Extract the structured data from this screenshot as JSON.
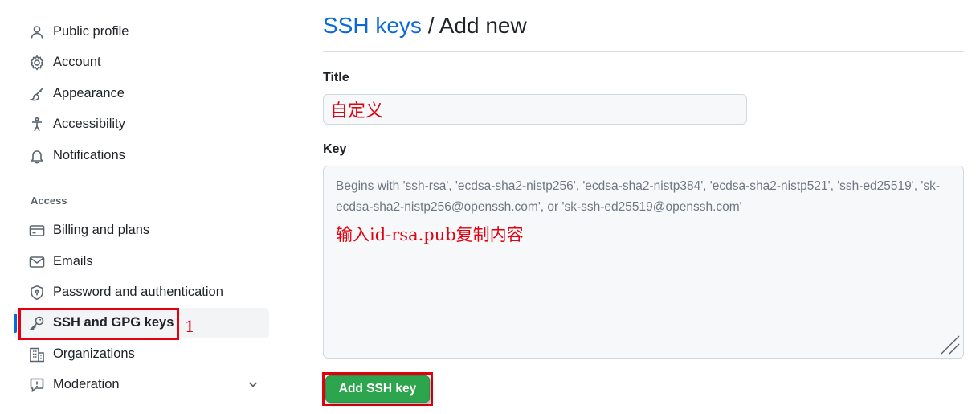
{
  "sidebar": {
    "items": [
      {
        "label": "Public profile",
        "icon": "person-icon"
      },
      {
        "label": "Account",
        "icon": "gear-icon"
      },
      {
        "label": "Appearance",
        "icon": "paintbrush-icon"
      },
      {
        "label": "Accessibility",
        "icon": "accessibility-icon"
      },
      {
        "label": "Notifications",
        "icon": "bell-icon"
      }
    ],
    "access_heading": "Access",
    "access_items": [
      {
        "label": "Billing and plans",
        "icon": "credit-card-icon"
      },
      {
        "label": "Emails",
        "icon": "mail-icon"
      },
      {
        "label": "Password and authentication",
        "icon": "shield-lock-icon"
      },
      {
        "label": "SSH and GPG keys",
        "icon": "key-icon",
        "active": true
      },
      {
        "label": "Organizations",
        "icon": "organization-icon"
      },
      {
        "label": "Moderation",
        "icon": "report-icon",
        "expandable": true
      }
    ]
  },
  "annotations": {
    "sidebar_step": "1",
    "title_example": "自定义",
    "key_instruction": "输入id-rsa.pub复制内容"
  },
  "main": {
    "breadcrumb_link": "SSH keys",
    "breadcrumb_separator": "/",
    "page_title": "Add new",
    "title_label": "Title",
    "key_label": "Key",
    "key_placeholder": "Begins with 'ssh-rsa', 'ecdsa-sha2-nistp256', 'ecdsa-sha2-nistp384', 'ecdsa-sha2-nistp521', 'ssh-ed25519', 'sk-ecdsa-sha2-nistp256@openssh.com', or 'sk-ssh-ed25519@openssh.com'",
    "submit_label": "Add SSH key"
  },
  "colors": {
    "link_blue": "#0969da",
    "active_indicator": "#0969da",
    "primary_button": "#2da44e",
    "annotation_red": "#e3000f"
  }
}
